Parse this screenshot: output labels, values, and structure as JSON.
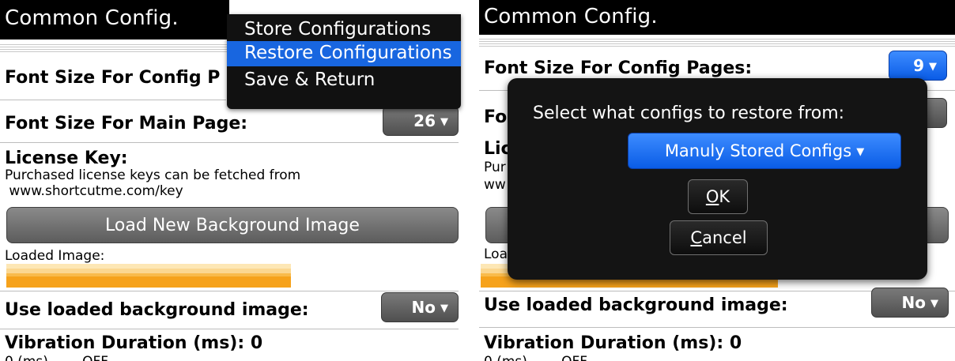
{
  "left": {
    "title": "Common Config.",
    "rows": {
      "font_config_label": "Font Size For Config P",
      "font_main_label": "Font Size For Main Page:",
      "font_main_value": "26",
      "license_label": "License Key:",
      "license_desc_1": "Purchased license keys can be fetched from",
      "license_desc_2": " www.shortcutme.com/key",
      "load_bg_button": "Load New Background Image",
      "loaded_image_label": "Loaded Image:",
      "use_bg_label": "Use loaded background image:",
      "use_bg_value": "No",
      "vibration_label": "Vibration Duration (ms): 0",
      "vibration_sub": "0 (ms)        OFF"
    },
    "menu": {
      "items": [
        "Store Configurations",
        "Restore Configurations",
        "Save & Return"
      ],
      "selected_index": 1
    }
  },
  "right": {
    "title": "Common Config.",
    "rows": {
      "font_config_label": "Font Size For Config Pages:",
      "font_config_value": "9",
      "font_main_label_partial": "Fo",
      "license_label_partial": "Lic",
      "license_desc_partial_1": "Pur",
      "license_desc_partial_2": "ww",
      "loaded_partial": "Loa",
      "use_bg_label": "Use loaded background image:",
      "use_bg_value": "No",
      "vibration_label": "Vibration Duration (ms): 0",
      "vibration_sub": "0 (ms)        OFF"
    },
    "dialog": {
      "title": "Select what configs to restore from:",
      "select_value": "Manuly Stored Configs",
      "ok_label_first": "O",
      "ok_label_rest": "K",
      "cancel_label_first": "C",
      "cancel_label_rest": "ancel"
    }
  },
  "icons": {
    "caret": "▼"
  },
  "colors": {
    "title_bar": "#000000",
    "dropdown_gray": "#5a5a5a",
    "dropdown_blue": "#1866e0",
    "menu_highlight": "#1866e0",
    "image_bar": "#f6a21b"
  }
}
